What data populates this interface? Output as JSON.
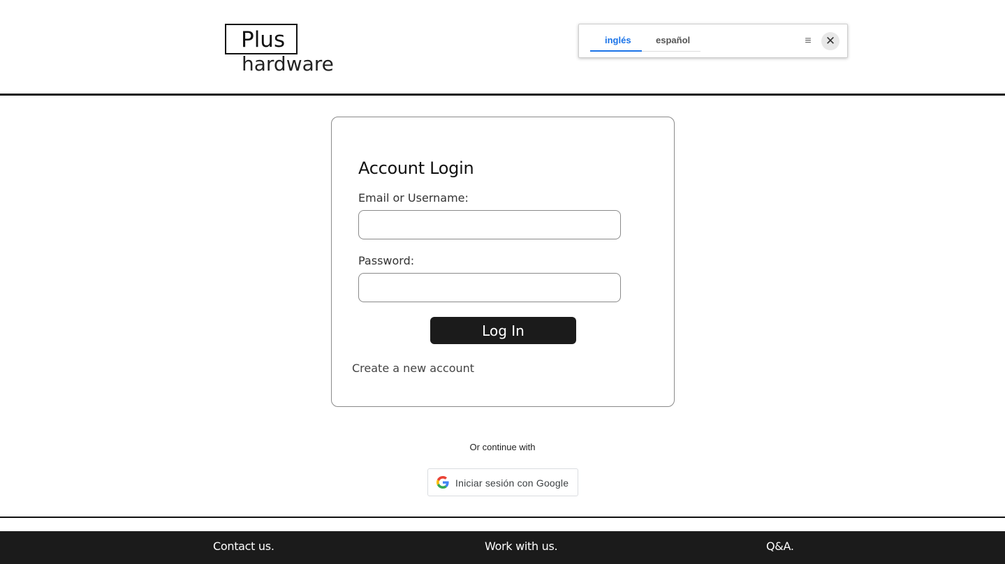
{
  "header": {
    "logo_top": "Plus",
    "logo_bottom": "hardware"
  },
  "translate": {
    "tabs": [
      {
        "label": "inglés",
        "active": true
      },
      {
        "label": "español",
        "active": false
      }
    ],
    "menu_icon": "menu-icon",
    "close_icon": "close-icon",
    "accent_color": "#1a73e8"
  },
  "login": {
    "title": "Account Login",
    "email_label": "Email or Username:",
    "email_value": "",
    "password_label": "Password:",
    "password_value": "",
    "submit_label": "Log In",
    "create_account_label": "Create a new account"
  },
  "social": {
    "continue_text": "Or continue with",
    "google_label": "Iniciar sesión con Google",
    "google_icon": "google-g-icon"
  },
  "footer": {
    "links": [
      "Contact us.",
      "Work with us.",
      "Q&A."
    ]
  },
  "colors": {
    "dark": "#1b1b1b",
    "background": "#ffffff"
  }
}
